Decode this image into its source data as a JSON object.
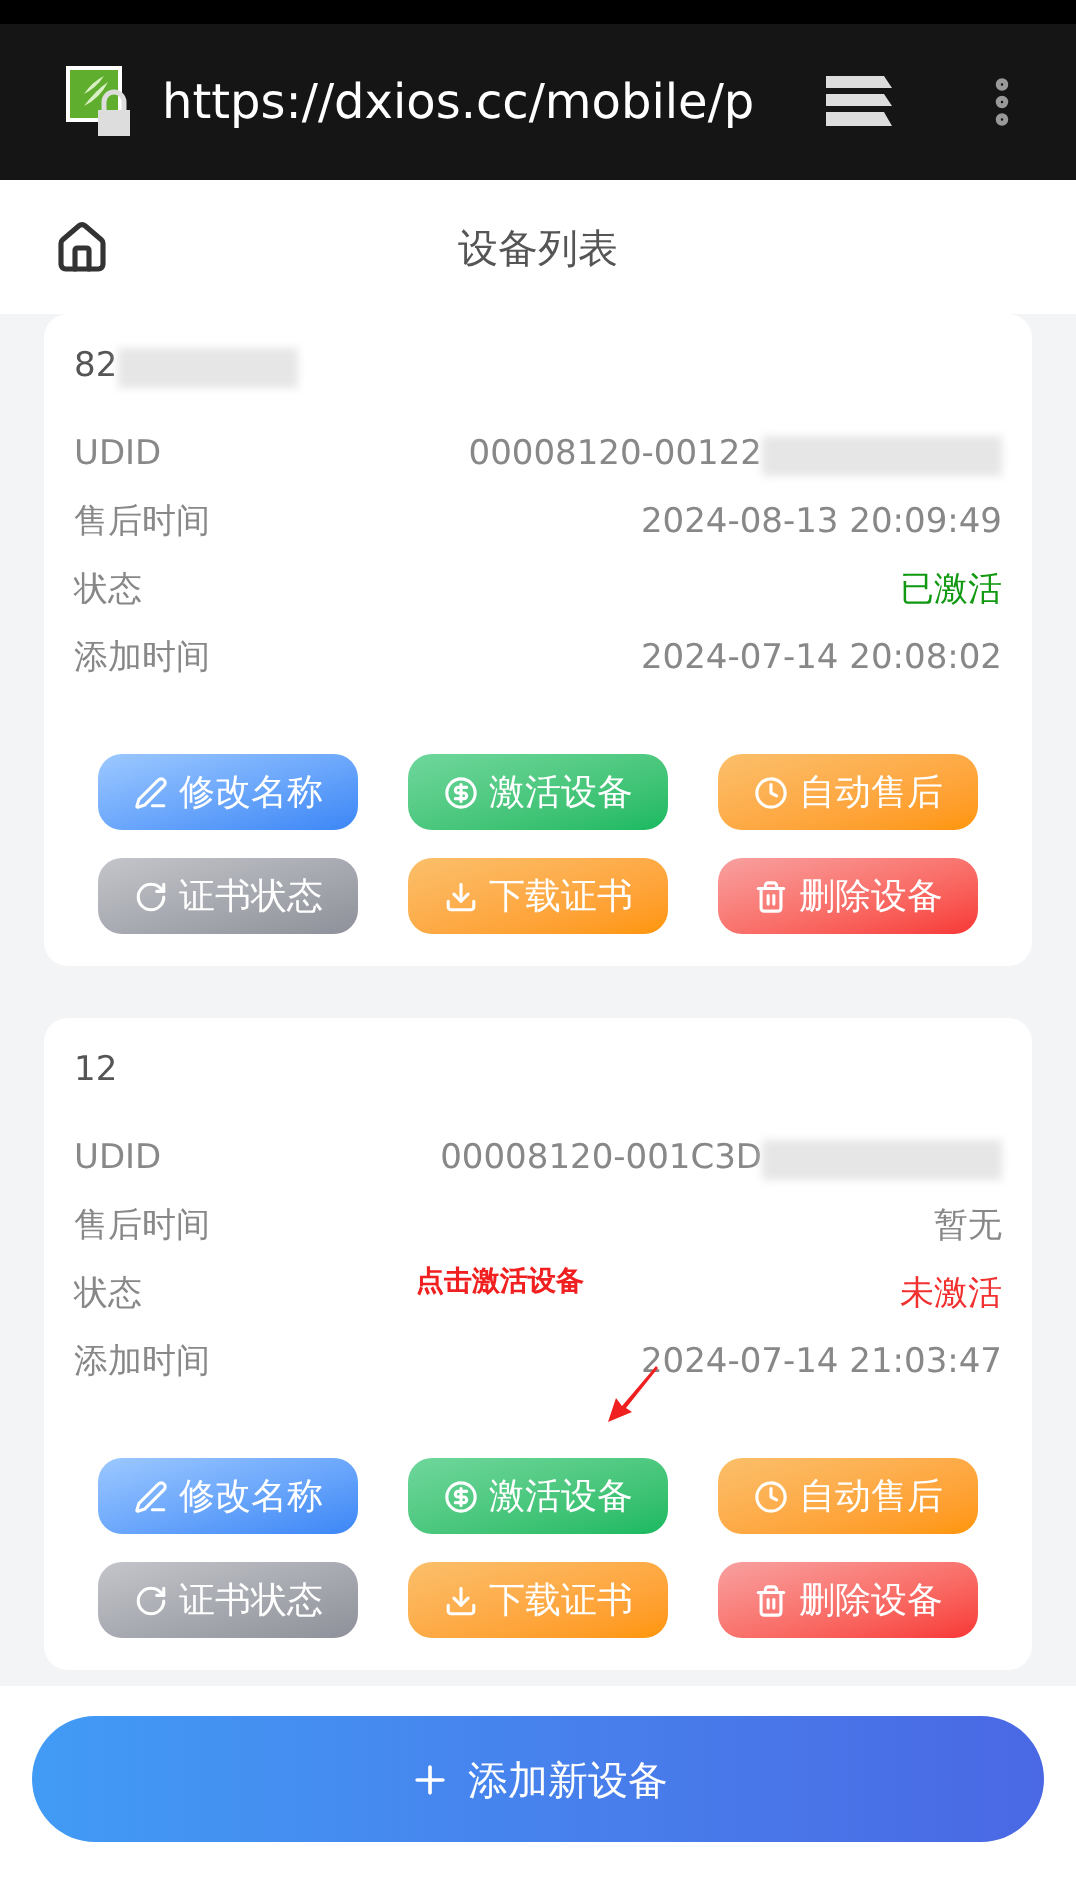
{
  "browser": {
    "url": "https://dxios.cc/mobile/p"
  },
  "header": {
    "title": "设备列表"
  },
  "devices": [
    {
      "name": "82",
      "name_redacted": true,
      "fields": [
        {
          "label": "UDID",
          "value": "00008120-00122",
          "redacted": true,
          "kind": "text"
        },
        {
          "label": "售后时间",
          "value": "2024-08-13 20:09:49",
          "kind": "text"
        },
        {
          "label": "状态",
          "value": "已激活",
          "kind": "status",
          "activated": true
        },
        {
          "label": "添加时间",
          "value": "2024-07-14 20:08:02",
          "kind": "text"
        }
      ],
      "buttons": [
        {
          "kind": "rename",
          "label": "修改名称"
        },
        {
          "kind": "activate",
          "label": "激活设备"
        },
        {
          "kind": "aftersale",
          "label": "自动售后"
        },
        {
          "kind": "cert_status",
          "label": "证书状态"
        },
        {
          "kind": "download",
          "label": "下载证书"
        },
        {
          "kind": "delete",
          "label": "删除设备"
        }
      ]
    },
    {
      "name": "12",
      "annotation": "点击激活设备",
      "fields": [
        {
          "label": "UDID",
          "value": "00008120-001C3D",
          "redacted": true,
          "kind": "text"
        },
        {
          "label": "售后时间",
          "value": "暂无",
          "kind": "text"
        },
        {
          "label": "状态",
          "value": "未激活",
          "kind": "status",
          "activated": false
        },
        {
          "label": "添加时间",
          "value": "2024-07-14 21:03:47",
          "kind": "text"
        }
      ],
      "buttons": [
        {
          "kind": "rename",
          "label": "修改名称"
        },
        {
          "kind": "activate",
          "label": "激活设备"
        },
        {
          "kind": "aftersale",
          "label": "自动售后"
        },
        {
          "kind": "cert_status",
          "label": "证书状态"
        },
        {
          "kind": "download",
          "label": "下载证书"
        },
        {
          "kind": "delete",
          "label": "删除设备"
        }
      ]
    }
  ],
  "add_button": {
    "label": "添加新设备"
  }
}
